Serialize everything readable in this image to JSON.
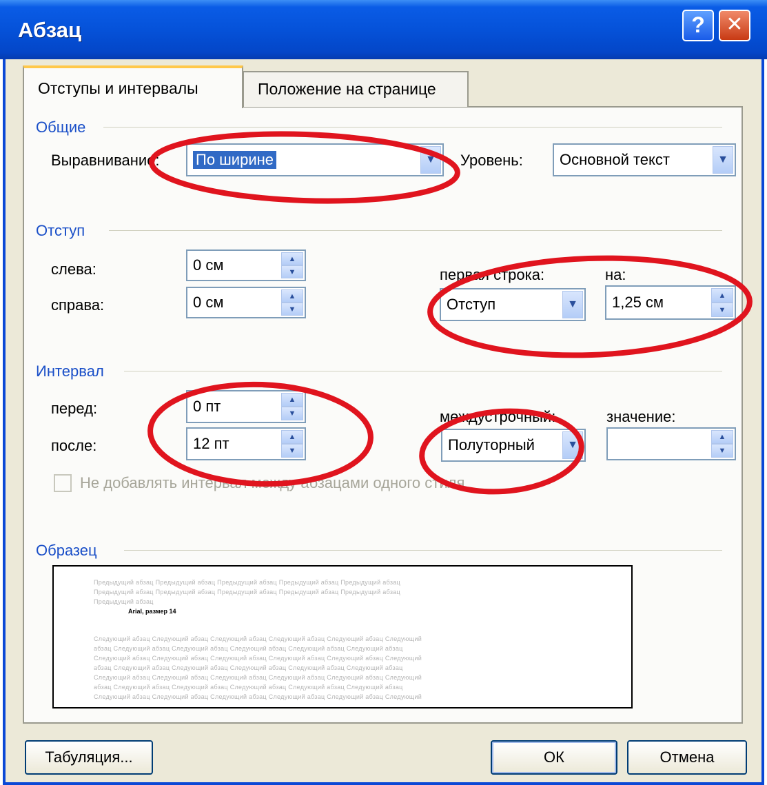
{
  "window": {
    "title": "Абзац",
    "help_label": "?",
    "close_label": "✕"
  },
  "tabs": [
    {
      "label": "Отступы и интервалы",
      "active": true
    },
    {
      "label": "Положение на странице",
      "active": false
    }
  ],
  "general": {
    "title": "Общие",
    "alignment_label": "Выравнивание:",
    "alignment_value": "По ширине",
    "level_label": "Уровень:",
    "level_value": "Основной текст"
  },
  "indent": {
    "title": "Отступ",
    "left_label": "слева:",
    "left_value": "0 см",
    "right_label": "справа:",
    "right_value": "0 см",
    "first_line_label": "первая строка:",
    "first_line_value": "Отступ",
    "by_label": "на:",
    "by_value": "1,25 см"
  },
  "spacing": {
    "title": "Интервал",
    "before_label": "перед:",
    "before_value": "0 пт",
    "after_label": "после:",
    "after_value": "12 пт",
    "line_label": "междустрочный:",
    "line_value": "Полуторный",
    "value_label": "значение:",
    "value_value": "",
    "no_space_label": "Не добавлять интервал между абзацами одного стиля"
  },
  "preview": {
    "title": "Образец",
    "prev_lines": [
      "Предыдущий абзац Предыдущий абзац Предыдущий абзац Предыдущий абзац Предыдущий абзац",
      "Предыдущий абзац Предыдущий абзац Предыдущий абзац Предыдущий абзац Предыдущий абзац",
      "Предыдущий абзац"
    ],
    "current_line": "Arial, размер 14",
    "next_lines": [
      "Следующий абзац Следующий абзац Следующий абзац Следующий абзац Следующий абзац Следующий",
      "абзац Следующий абзац Следующий абзац Следующий абзац Следующий абзац Следующий абзац",
      "Следующий абзац Следующий абзац Следующий абзац Следующий абзац Следующий абзац Следующий",
      "абзац Следующий абзац Следующий абзац Следующий абзац Следующий абзац Следующий абзац",
      "Следующий абзац Следующий абзац Следующий абзац Следующий абзац Следующий абзац Следующий",
      "абзац Следующий абзац Следующий абзац Следующий абзац Следующий абзац Следующий абзац",
      "Следующий абзац Следующий абзац Следующий абзац Следующий абзац Следующий абзац Следующий"
    ]
  },
  "buttons": {
    "tabs": "Табуляция...",
    "ok": "ОК",
    "cancel": "Отмена"
  },
  "colors": {
    "annotation": "#e0141e",
    "group_title": "#1a4fc8",
    "title_bar": "#0552d9"
  }
}
